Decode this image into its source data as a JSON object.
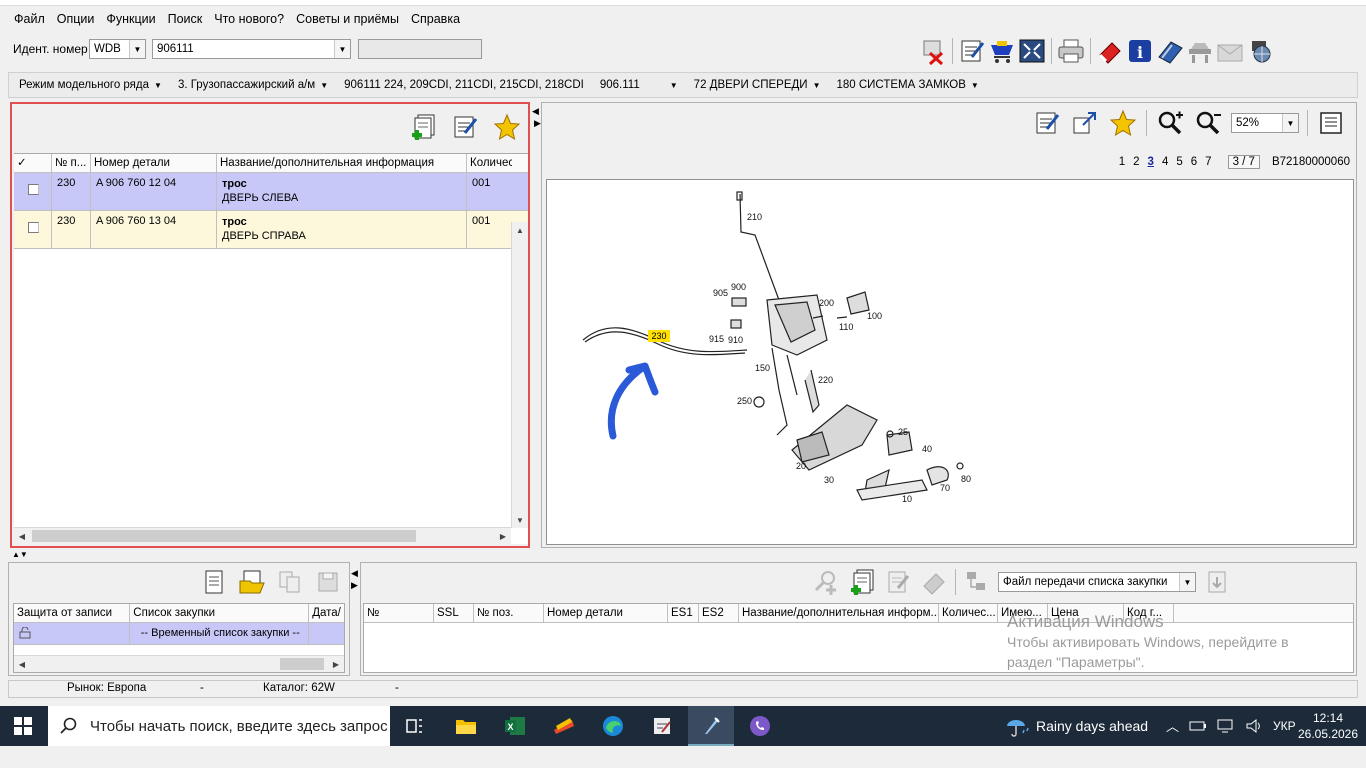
{
  "menu": [
    "Файл",
    "Опции",
    "Функции",
    "Поиск",
    "Что нового?",
    "Советы и приёмы",
    "Справка"
  ],
  "ident": {
    "label": "Идент. номер",
    "prefix": "WDB",
    "number": "906111",
    "extra": ""
  },
  "toolbar_icons": [
    "delete-red-x-icon",
    "edit-notes-icon",
    "basket-icon",
    "fullscreen-icon",
    "printer-icon",
    "eraser-icon",
    "info-icon",
    "book-icon",
    "car-lift-icon",
    "mail-icon",
    "globe-icon"
  ],
  "breadcrumbs": [
    "Режим модельного ряда",
    "3. Грузопассажирский а/м",
    "906111 224, 209CDI, 211CDI, 215CDI, 218CDI",
    "906.111",
    "72 ДВЕРИ СПЕРЕДИ",
    "180 СИСТЕМА ЗАМКОВ"
  ],
  "parts_table": {
    "columns": [
      "✓",
      "№ п...",
      "Номер детали",
      "Название/дополнительная информация",
      "Количес"
    ],
    "rows": [
      {
        "pos": "230",
        "part": "A 906 760 12 04",
        "name": "трос",
        "info": "ДВЕРЬ СЛЕВА",
        "qty": "001",
        "selected": true
      },
      {
        "pos": "230",
        "part": "A 906 760 13 04",
        "name": "трос",
        "info": "ДВЕРЬ СПРАВА",
        "qty": "001",
        "selected": false
      }
    ]
  },
  "viewer": {
    "zoom": "52%",
    "pages": [
      "1",
      "2",
      "3",
      "4",
      "5",
      "6",
      "7"
    ],
    "current_page": "3",
    "page_counter": "3 / 7",
    "image_id": "B72180000060",
    "callouts": [
      "210",
      "900",
      "905",
      "200",
      "100",
      "110",
      "230",
      "915",
      "910",
      "150",
      "220",
      "250",
      "25",
      "40",
      "20",
      "30",
      "70",
      "80",
      "10"
    ]
  },
  "cart": {
    "columns": [
      "Защита от записи",
      "Список закупки",
      "Дата/"
    ],
    "row": "-- Временный список закупки --"
  },
  "order": {
    "file_select": "Файл передачи списка закупки",
    "columns": [
      "№",
      "SSL",
      "№ поз.",
      "Номер детали",
      "ES1",
      "ES2",
      "Название/дополнительная информ...",
      "Количес...",
      "Имею...",
      "Цена",
      "Код г..."
    ]
  },
  "status": {
    "market": "Рынок: Европа",
    "dash1": "-",
    "catalog": "Каталог: 62W",
    "dash2": "-"
  },
  "watermark": {
    "title": "Активация Windows",
    "line1": "Чтобы активировать Windows, перейдите в",
    "line2": "раздел \"Параметры\"."
  },
  "taskbar": {
    "search": "Чтобы начать поиск, введите здесь запрос",
    "weather": "Rainy days ahead",
    "lang": "УКР",
    "time": "12:14",
    "date": "26.05.2026"
  },
  "colors": {
    "selected_row": "#c8c8f8",
    "second_row": "#fdf8dc",
    "highlight_label": "#ffe000",
    "arrow": "#2a5ad8",
    "taskbar": "#1c2a3a"
  }
}
